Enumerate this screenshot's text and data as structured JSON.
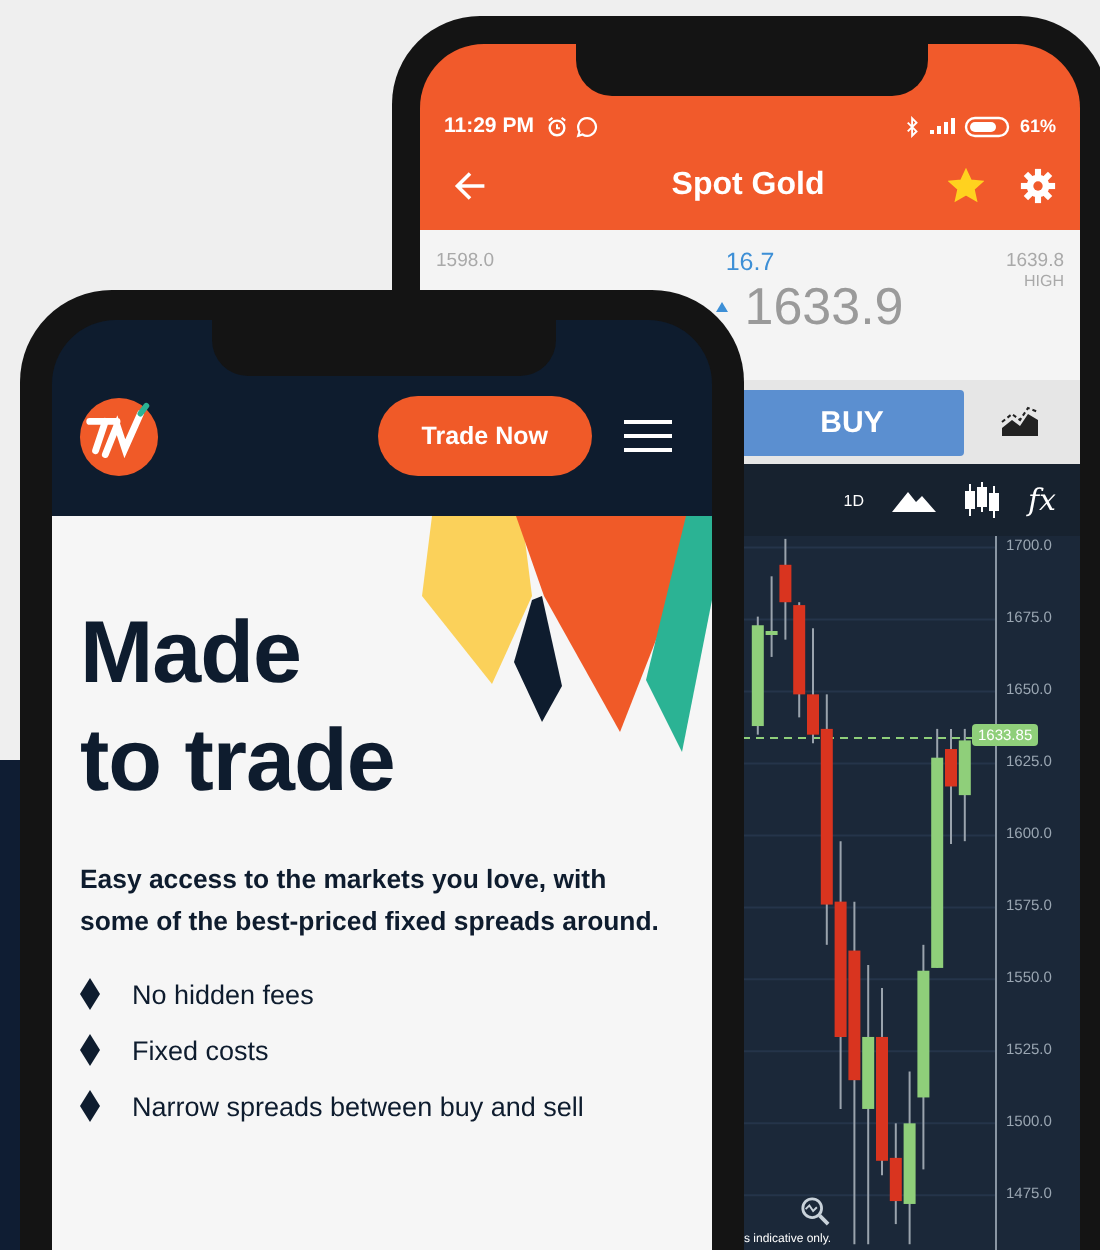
{
  "back_phone": {
    "status_bar": {
      "time": "11:29 PM",
      "battery": "61%"
    },
    "title": "Spot Gold",
    "favorite": true,
    "quote": {
      "low_value": "1598.0",
      "change": "16.7",
      "high_value": "1639.8",
      "high_label": "HIGH",
      "price": "1633.9"
    },
    "buy_button": "BUY",
    "toolbar": {
      "period": "1D",
      "formula": "fx"
    },
    "chart": {
      "chart_data": {
        "type": "candlestick",
        "grid": true,
        "ohlc": [
          [
            1638,
            1676,
            1635,
            1673
          ],
          [
            1670,
            1690,
            1662,
            1671
          ],
          [
            1694,
            1703,
            1668,
            1681
          ],
          [
            1680,
            1681,
            1641,
            1649
          ],
          [
            1649,
            1672,
            1632,
            1635
          ],
          [
            1637,
            1649,
            1562,
            1576
          ],
          [
            1577,
            1598,
            1505,
            1530
          ],
          [
            1560,
            1577,
            1458,
            1515
          ],
          [
            1505,
            1555,
            1458,
            1530
          ],
          [
            1530,
            1547,
            1482,
            1487
          ],
          [
            1488,
            1500,
            1465,
            1473
          ],
          [
            1472,
            1518,
            1458,
            1500
          ],
          [
            1509,
            1562,
            1484,
            1553
          ],
          [
            1554,
            1637,
            1554,
            1627
          ],
          [
            1630,
            1637,
            1597,
            1617
          ],
          [
            1614,
            1637,
            1598,
            1633
          ]
        ],
        "ylim": [
          1456,
          1704
        ],
        "yticks": [
          {
            "value": 1700,
            "label": "1700.0"
          },
          {
            "value": 1675,
            "label": "1675.0"
          },
          {
            "value": 1650,
            "label": "1650.0"
          },
          {
            "value": 1625,
            "label": "1625.0"
          },
          {
            "value": 1600,
            "label": "1600.0"
          },
          {
            "value": 1575,
            "label": "1575.0"
          },
          {
            "value": 1550,
            "label": "1550.0"
          },
          {
            "value": 1525,
            "label": "1525.0"
          },
          {
            "value": 1500,
            "label": "1500.0"
          },
          {
            "value": 1475,
            "label": "1475.0"
          }
        ],
        "ref_lines": [
          {
            "axis": "y",
            "value": 1633.85,
            "label": "1633.85"
          }
        ]
      },
      "disclaimer": "s indicative only."
    }
  },
  "front_phone": {
    "cta_button": "Trade Now",
    "headline": "Made\nto trade",
    "intro": "Easy access to the markets you love, with some of the best-priced fixed spreads around.",
    "features": [
      "No hidden fees",
      "Fixed costs",
      "Narrow spreads  between buy and sell"
    ]
  }
}
